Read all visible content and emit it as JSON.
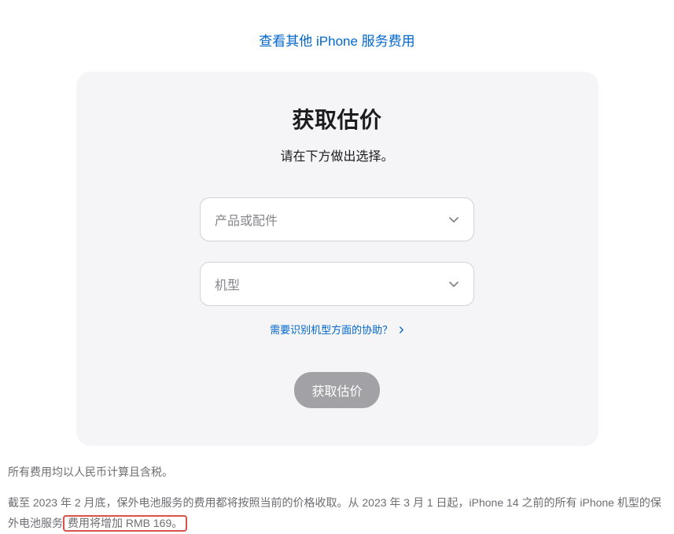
{
  "topLink": {
    "label": "查看其他 iPhone 服务费用"
  },
  "card": {
    "title": "获取估价",
    "subtitle": "请在下方做出选择。",
    "select1": {
      "placeholder": "产品或配件"
    },
    "select2": {
      "placeholder": "机型"
    },
    "helpLink": {
      "label": "需要识别机型方面的协助？"
    },
    "submit": {
      "label": "获取估价"
    }
  },
  "footer": {
    "line1": "所有费用均以人民币计算且含税。",
    "line2_a": "截至 2023 年 2 月底，保外电池服务的费用都将按照当前的价格收取。从 2023 年 3 月 1 日起，iPhone 14 之前的所有 iPhone 机型的保外电池服务",
    "line2_b": "费用将增加 RMB 169。"
  }
}
